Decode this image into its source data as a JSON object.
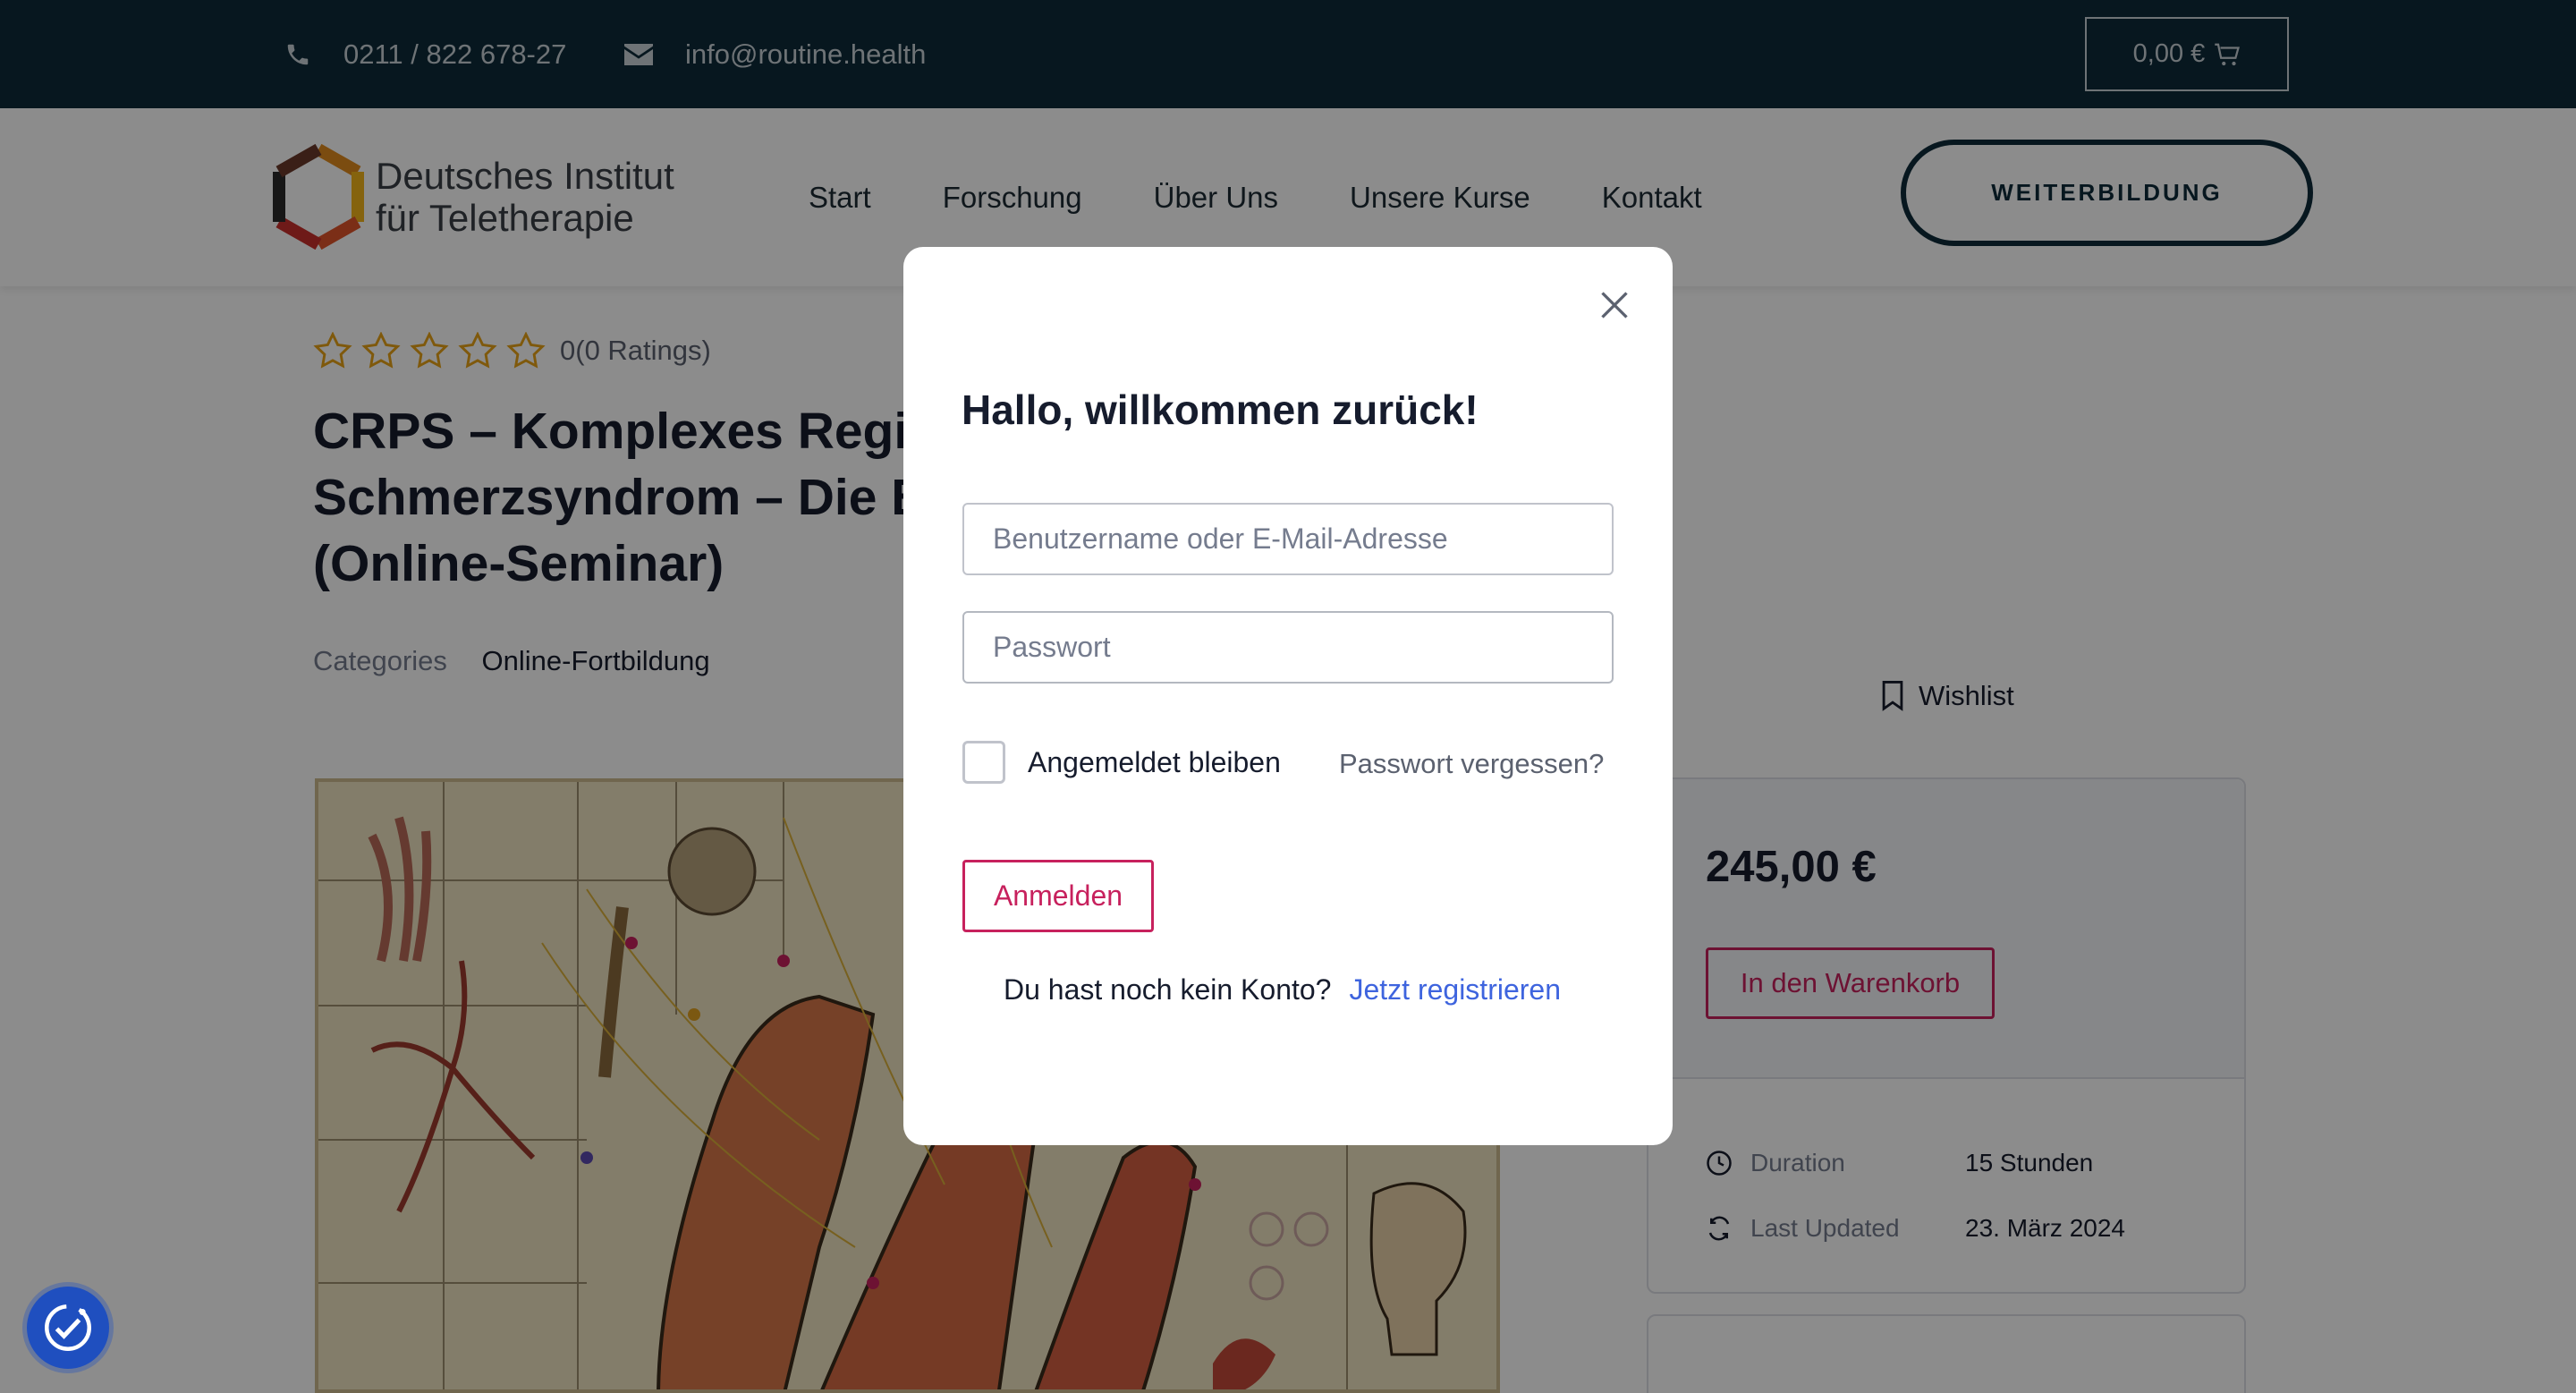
{
  "topbar": {
    "phone": "0211 / 822 678-27",
    "email": "info@routine.health",
    "cart_total": "0,00 €",
    "bg_color": "#0e2b39"
  },
  "header": {
    "logo_line1": "Deutsches Institut",
    "logo_line2": "für Teletherapie",
    "nav": [
      "Start",
      "Forschung",
      "Über Uns",
      "Unsere Kurse",
      "Kontakt"
    ],
    "cta_label": "WEITERBILDUNG"
  },
  "course": {
    "rating_text": "0(0 Ratings)",
    "stars_filled": 0,
    "stars_total": 5,
    "title": "CRPS – Komplexes Regionales Schmerzsyndrom – Die Behandlung (Online-Seminar)",
    "categories_label": "Categories",
    "category": "Online-Fortbildung",
    "wishlist_label": "Wishlist"
  },
  "sidebar": {
    "price": "245,00 €",
    "add_to_cart": "In den Warenkorb",
    "duration_label": "Duration",
    "duration_value": "15 Stunden",
    "updated_label": "Last Updated",
    "updated_value": "23. März 2024",
    "accent_color": "#c7215d"
  },
  "modal": {
    "title": "Hallo, willkommen zurück!",
    "username_placeholder": "Benutzername oder E-Mail-Adresse",
    "password_placeholder": "Passwort",
    "remember_label": "Angemeldet bleiben",
    "forgot_label": "Passwort vergessen?",
    "login_label": "Anmelden",
    "no_account_text": "Du hast noch kein Konto?",
    "register_label": "Jetzt registrieren",
    "link_color": "#3e64de"
  },
  "icons": {
    "phone": "phone-icon",
    "email": "envelope-icon",
    "cart": "cart-icon",
    "close": "close-icon",
    "wishlist": "bookmark-icon",
    "duration": "clock-icon",
    "updated": "refresh-icon",
    "accessibility": "accessibility-icon"
  }
}
